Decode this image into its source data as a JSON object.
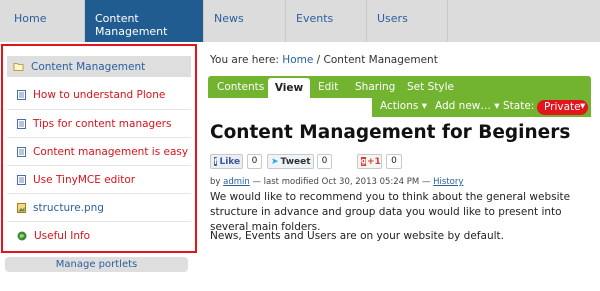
{
  "topnav": {
    "tabs": [
      "Home",
      "Content Management",
      "News",
      "Events",
      "Users"
    ]
  },
  "portlet": {
    "header": "Content Management",
    "items": [
      "How to understand Plone",
      "Tips for content managers",
      "Content management is easy",
      "Use TinyMCE editor",
      "structure.png",
      "Useful Info"
    ]
  },
  "manage_portlets": "Manage portlets",
  "breadcrumb": {
    "prefix": "You are here:",
    "home": "Home",
    "separator": "/",
    "current": "Content Management"
  },
  "editbar": {
    "tabs": [
      "Contents",
      "View",
      "Edit",
      "Sharing",
      "Set Style"
    ],
    "actions": "Actions ▾",
    "add_new": "Add new… ▾",
    "state_label": "State:",
    "state_value": "Private",
    "state_arrow": "▾"
  },
  "page_title": "Content Management for Beginers",
  "social": {
    "like": "Like",
    "like_count": "0",
    "tweet": "Tweet",
    "tweet_count": "0",
    "gplus": "+1",
    "gplus_count": "0"
  },
  "byline": {
    "by": "by",
    "author": "admin",
    "modified": "— last modified Oct 30, 2013 05:24 PM —",
    "history": "History"
  },
  "body": [
    "We would like to recommend you to think about the general website structure in advance and group data you would like to present into several main folders.",
    "News, Events and Users are on your website by default."
  ],
  "colors": {
    "nav_active": "#205c90",
    "link": "#2a5f9e",
    "highlight_red": "#e3141c",
    "edit_green": "#72b330"
  }
}
